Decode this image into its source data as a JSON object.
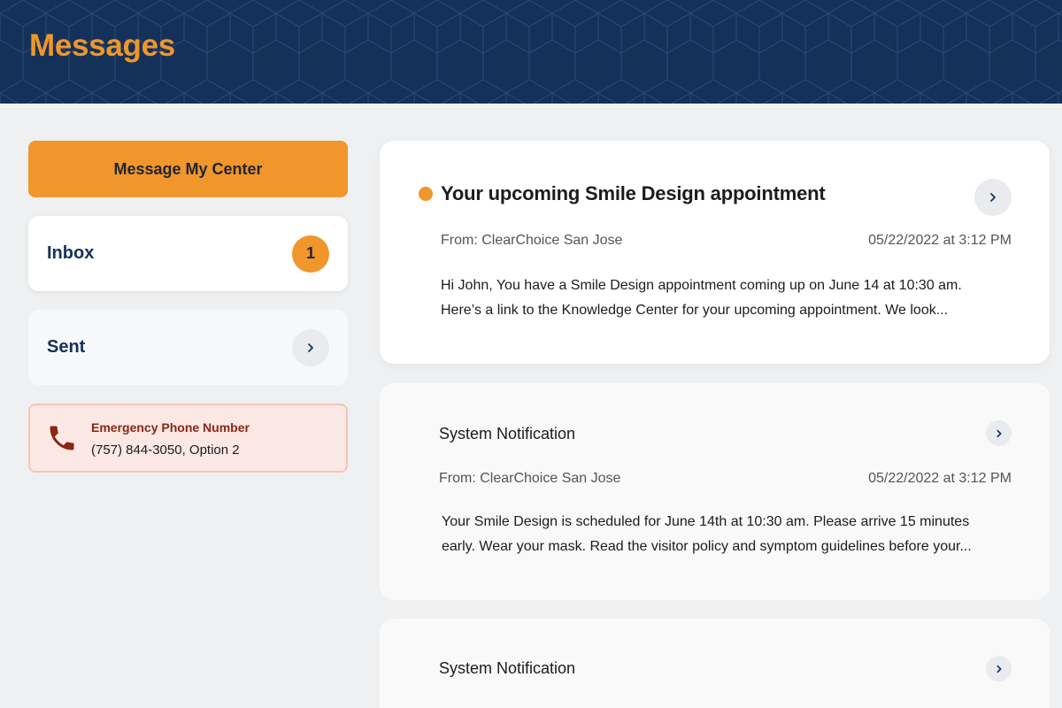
{
  "header": {
    "title": "Messages"
  },
  "sidebar": {
    "message_button": "Message My Center",
    "inbox": {
      "label": "Inbox",
      "count": "1"
    },
    "sent": {
      "label": "Sent"
    },
    "emergency": {
      "title": "Emergency Phone Number",
      "number": "(757) 844-3050, Option 2"
    }
  },
  "messages": [
    {
      "subject": "Your upcoming Smile Design appointment",
      "unread": true,
      "from": "From: ClearChoice San Jose",
      "date": "05/22/2022 at 3:12 PM",
      "preview_line1": "Hi John, You have a Smile Design appointment coming up on June 14 at 10:30 am.",
      "preview_line2": "Here’s a link to the Knowledge Center for your upcoming appointment. We look..."
    },
    {
      "subject": "System Notification",
      "unread": false,
      "from": "From: ClearChoice San Jose",
      "date": "05/22/2022 at 3:12 PM",
      "preview_line1": "Your Smile Design is scheduled for June 14th at 10:30 am. Please arrive 15 minutes",
      "preview_line2": "early. Wear your mask. Read the visitor policy and symptom guidelines before your..."
    },
    {
      "subject": "System Notification",
      "unread": false
    }
  ],
  "colors": {
    "navy": "#14315a",
    "accent": "#f0962a",
    "emergency_red": "#8b2612"
  },
  "icons": [
    "phone-icon",
    "chevron-right-icon"
  ]
}
